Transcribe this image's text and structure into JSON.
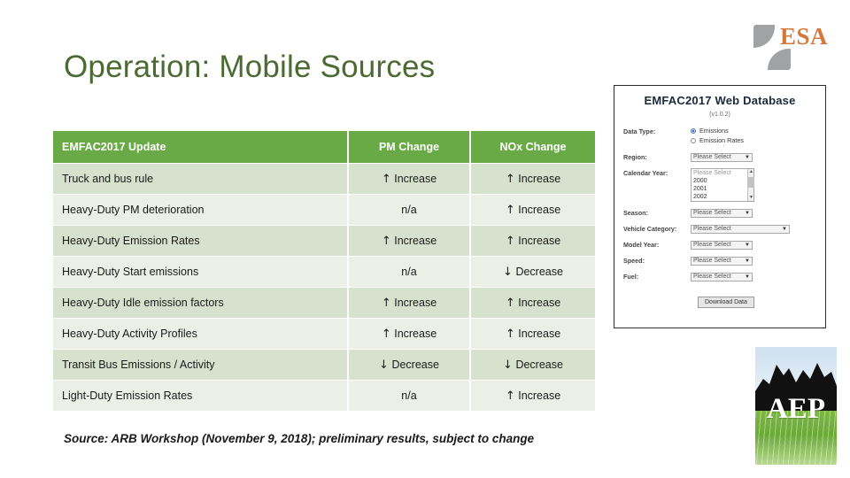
{
  "slide": {
    "title": "Operation: Mobile Sources",
    "source_note": "Source: ARB Workshop (November 9, 2018); preliminary results, subject to change"
  },
  "brand": {
    "esa_logo_text": "ESA",
    "aep_logo_text": "AEP",
    "title_color": "#4c6b33",
    "header_green": "#6aaa46",
    "increase_color": "#c00000",
    "decrease_color": "#1e8a54",
    "esa_orange": "#d4793c"
  },
  "table": {
    "headers": {
      "name": "EMFAC2017 Update",
      "pm": "PM Change",
      "nox": "NOx Change"
    },
    "rows": [
      {
        "name": "Truck and bus rule",
        "pm": "Increase",
        "pm_arrow": "↑",
        "pm_kind": "increase",
        "nox": "Increase",
        "nox_arrow": "↑",
        "nox_kind": "increase"
      },
      {
        "name": "Heavy-Duty PM deterioration",
        "pm": "n/a",
        "pm_arrow": "",
        "pm_kind": "na",
        "nox": "Increase",
        "nox_arrow": "↑",
        "nox_kind": "increase"
      },
      {
        "name": "Heavy-Duty Emission Rates",
        "pm": "Increase",
        "pm_arrow": "↑",
        "pm_kind": "increase",
        "nox": "Increase",
        "nox_arrow": "↑",
        "nox_kind": "increase"
      },
      {
        "name": "Heavy-Duty Start emissions",
        "pm": "n/a",
        "pm_arrow": "",
        "pm_kind": "na",
        "nox": "Decrease",
        "nox_arrow": "↓",
        "nox_kind": "decrease"
      },
      {
        "name": "Heavy-Duty Idle emission factors",
        "pm": "Increase",
        "pm_arrow": "↑",
        "pm_kind": "increase",
        "nox": "Increase",
        "nox_arrow": "↑",
        "nox_kind": "increase"
      },
      {
        "name": "Heavy-Duty Activity Profiles",
        "pm": "Increase",
        "pm_arrow": "↑",
        "pm_kind": "increase",
        "nox": "Increase",
        "nox_arrow": "↑",
        "nox_kind": "increase"
      },
      {
        "name": "Transit Bus Emissions / Activity",
        "pm": "Decrease",
        "pm_arrow": "↓",
        "pm_kind": "decrease",
        "nox": "Decrease",
        "nox_arrow": "↓",
        "nox_kind": "decrease"
      },
      {
        "name": "Light-Duty Emission Rates",
        "pm": "n/a",
        "pm_arrow": "",
        "pm_kind": "na",
        "nox": "Increase",
        "nox_arrow": "↑",
        "nox_kind": "increase"
      }
    ]
  },
  "emfac_panel": {
    "title": "EMFAC2017 Web Database",
    "version": "(v1.0.2)",
    "fields": {
      "data_type_label": "Data Type:",
      "radio_emissions": "Emissions",
      "radio_emission_rates": "Emission Rates",
      "region_label": "Region:",
      "region_value": "Please Select",
      "calendar_year_label": "Calendar Year:",
      "calendar_year_options": [
        "Please Select",
        "2000",
        "2001",
        "2002"
      ],
      "season_label": "Season:",
      "season_value": "Please Select",
      "vehicle_category_label": "Vehicle Category:",
      "vehicle_category_value": "Please Select",
      "model_year_label": "Model Year:",
      "model_year_value": "Please Select",
      "speed_label": "Speed:",
      "speed_value": "Please Select",
      "fuel_label": "Fuel:",
      "fuel_value": "Please Select",
      "download_button": "Download Data"
    }
  }
}
